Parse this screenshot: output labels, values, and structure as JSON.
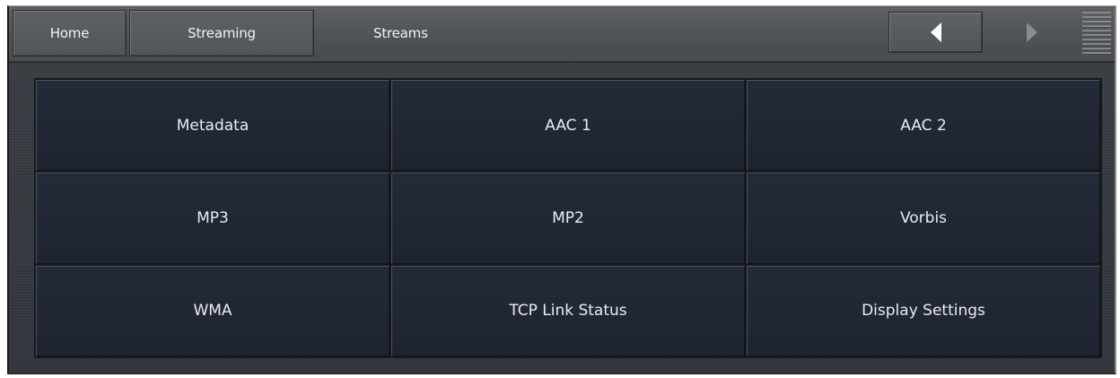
{
  "breadcrumb": {
    "home": "Home",
    "streaming": "Streaming",
    "current": "Streams"
  },
  "nav": {
    "back_icon": "triangle-left-icon",
    "forward_icon": "triangle-right-icon",
    "menu_icon": "menu-lines-icon"
  },
  "tiles": [
    {
      "label": "Metadata"
    },
    {
      "label": "AAC 1"
    },
    {
      "label": "AAC 2"
    },
    {
      "label": "MP3"
    },
    {
      "label": "MP2"
    },
    {
      "label": "Vorbis"
    },
    {
      "label": "WMA"
    },
    {
      "label": "TCP Link Status"
    },
    {
      "label": "Display Settings"
    }
  ],
  "colors": {
    "tile_bg": "#1f2532",
    "tile_text": "#e9ecef",
    "bar_bg": "#505357",
    "panel_bg": "#373b41"
  }
}
